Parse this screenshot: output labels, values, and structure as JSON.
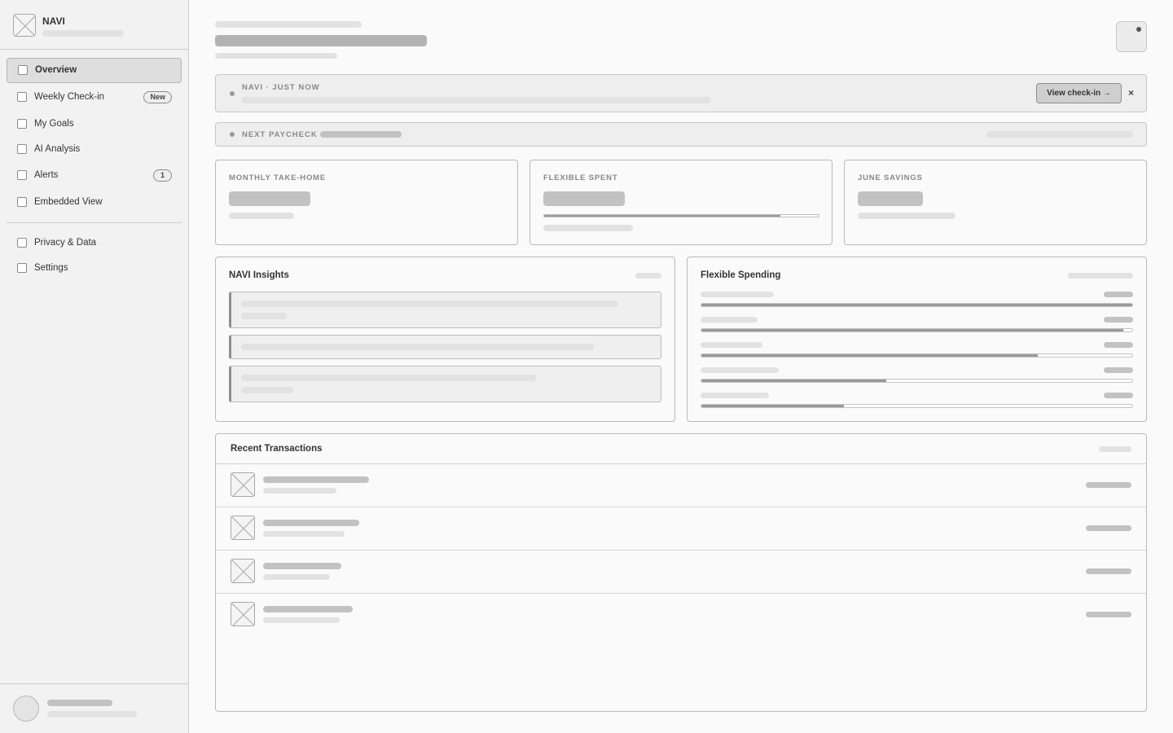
{
  "brand": {
    "name": "NAVI"
  },
  "sidebar": {
    "items": [
      {
        "label": "Overview",
        "active": true
      },
      {
        "label": "Weekly Check-in",
        "badge": "New"
      },
      {
        "label": "My Goals"
      },
      {
        "label": "AI Analysis"
      },
      {
        "label": "Alerts",
        "badge": "1"
      },
      {
        "label": "Embedded View"
      }
    ],
    "secondary_items": [
      {
        "label": "Privacy & Data"
      },
      {
        "label": "Settings"
      }
    ]
  },
  "notification": {
    "label": "NAVI · JUST NOW",
    "action_label": "View check-in →",
    "close_label": "×"
  },
  "paycheck": {
    "label": "NEXT PAYCHECK"
  },
  "stats": [
    {
      "label": "MONTHLY TAKE-HOME"
    },
    {
      "label": "FLEXIBLE SPENT",
      "progress": 0.86
    },
    {
      "label": "JUNE SAVINGS"
    }
  ],
  "insights": {
    "title": "NAVI Insights"
  },
  "flexible_spending": {
    "title": "Flexible Spending",
    "progress": [
      1.0,
      0.98,
      0.78,
      0.43,
      0.33
    ]
  },
  "transactions": {
    "title": "Recent Transactions"
  },
  "colors": {
    "accent": "#9a9a9a",
    "background": "#fafafa",
    "sidebar": "#f2f2f2"
  }
}
